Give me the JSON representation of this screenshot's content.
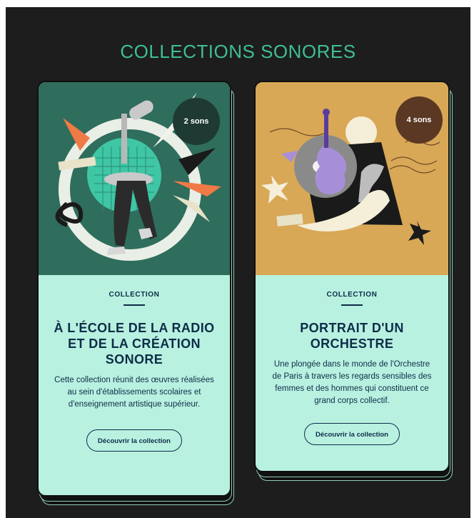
{
  "page": {
    "heading": "COLLECTIONS SONORES"
  },
  "colors": {
    "background": "#1d1d1d",
    "heading": "#3fbf93",
    "card_body": "#b8f1e0",
    "text": "#0e2c48",
    "card1_image": "#2f6d5c",
    "card2_image": "#d8a857"
  },
  "collections": [
    {
      "count_badge": "2 sons",
      "eyebrow": "COLLECTION",
      "title": "À L'ÉCOLE DE LA RADIO ET DE LA CRÉATION SONORE",
      "description": "Cette collection réunit des œuvres réalisées au sein d'établissements scolaires et d'enseignement artistique supérieur.",
      "cta_label": "Découvrir la collection",
      "image_icon": "microphone-collage-illustration"
    },
    {
      "count_badge": "4 sons",
      "eyebrow": "COLLECTION",
      "title": "PORTRAIT D'UN ORCHESTRE",
      "description": "Une plongée dans le monde de l'Orchestre de Paris à travers les regards sensibles des femmes et des hommes qui constituent ce grand corps collectif.",
      "cta_label": "Découvrir la collection",
      "image_icon": "violin-collage-illustration"
    }
  ]
}
